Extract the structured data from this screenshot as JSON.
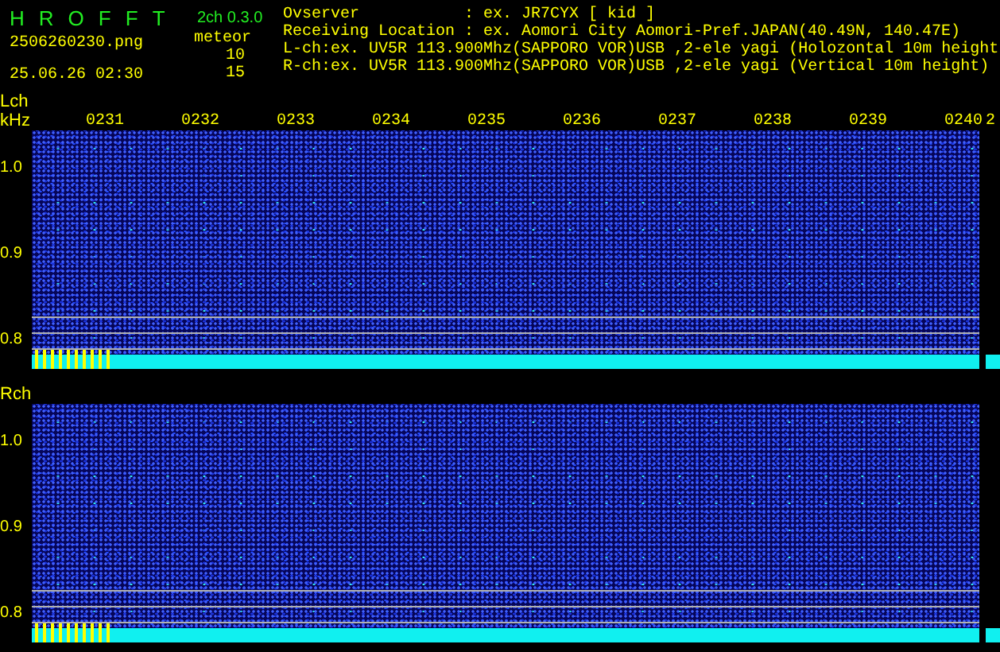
{
  "header": {
    "title_letters": [
      "H",
      "R",
      "O",
      "F",
      "F",
      "T"
    ],
    "version": "2ch 0.3.0",
    "filename": "2506260230.png",
    "datetime": "25.06.26 02:30",
    "meteor_label": "meteor",
    "meteor_counts": [
      "10",
      "15"
    ]
  },
  "info": [
    {
      "label": "Ovserver",
      "value": ": ex. JR7CYX [ kid ]"
    },
    {
      "label": "Receiving Location",
      "value": ": ex. Aomori City Aomori-Pref.JAPAN(40.49N, 140.47E)"
    },
    {
      "label": "L-ch:",
      "value": "ex. UV5R 113.900Mhz(SAPPORO VOR)USB ,2-ele yagi (Holozontal 10m height"
    },
    {
      "label": "R-ch:",
      "value": "ex. UV5R 113.900Mhz(SAPPORO VOR)USB ,2-ele yagi (Vertical 10m height)"
    }
  ],
  "channels": [
    {
      "label": "Lch",
      "unit": "kHz",
      "time_labels": [
        "0231",
        "0232",
        "0233",
        "0234",
        "0235",
        "0236",
        "0237",
        "0238",
        "0239",
        "0240",
        "2"
      ],
      "y_labels": [
        "1.0",
        "0.9",
        "0.8"
      ]
    },
    {
      "label": "Rch",
      "y_labels": [
        "1.0",
        "0.9",
        "0.8"
      ]
    }
  ]
}
